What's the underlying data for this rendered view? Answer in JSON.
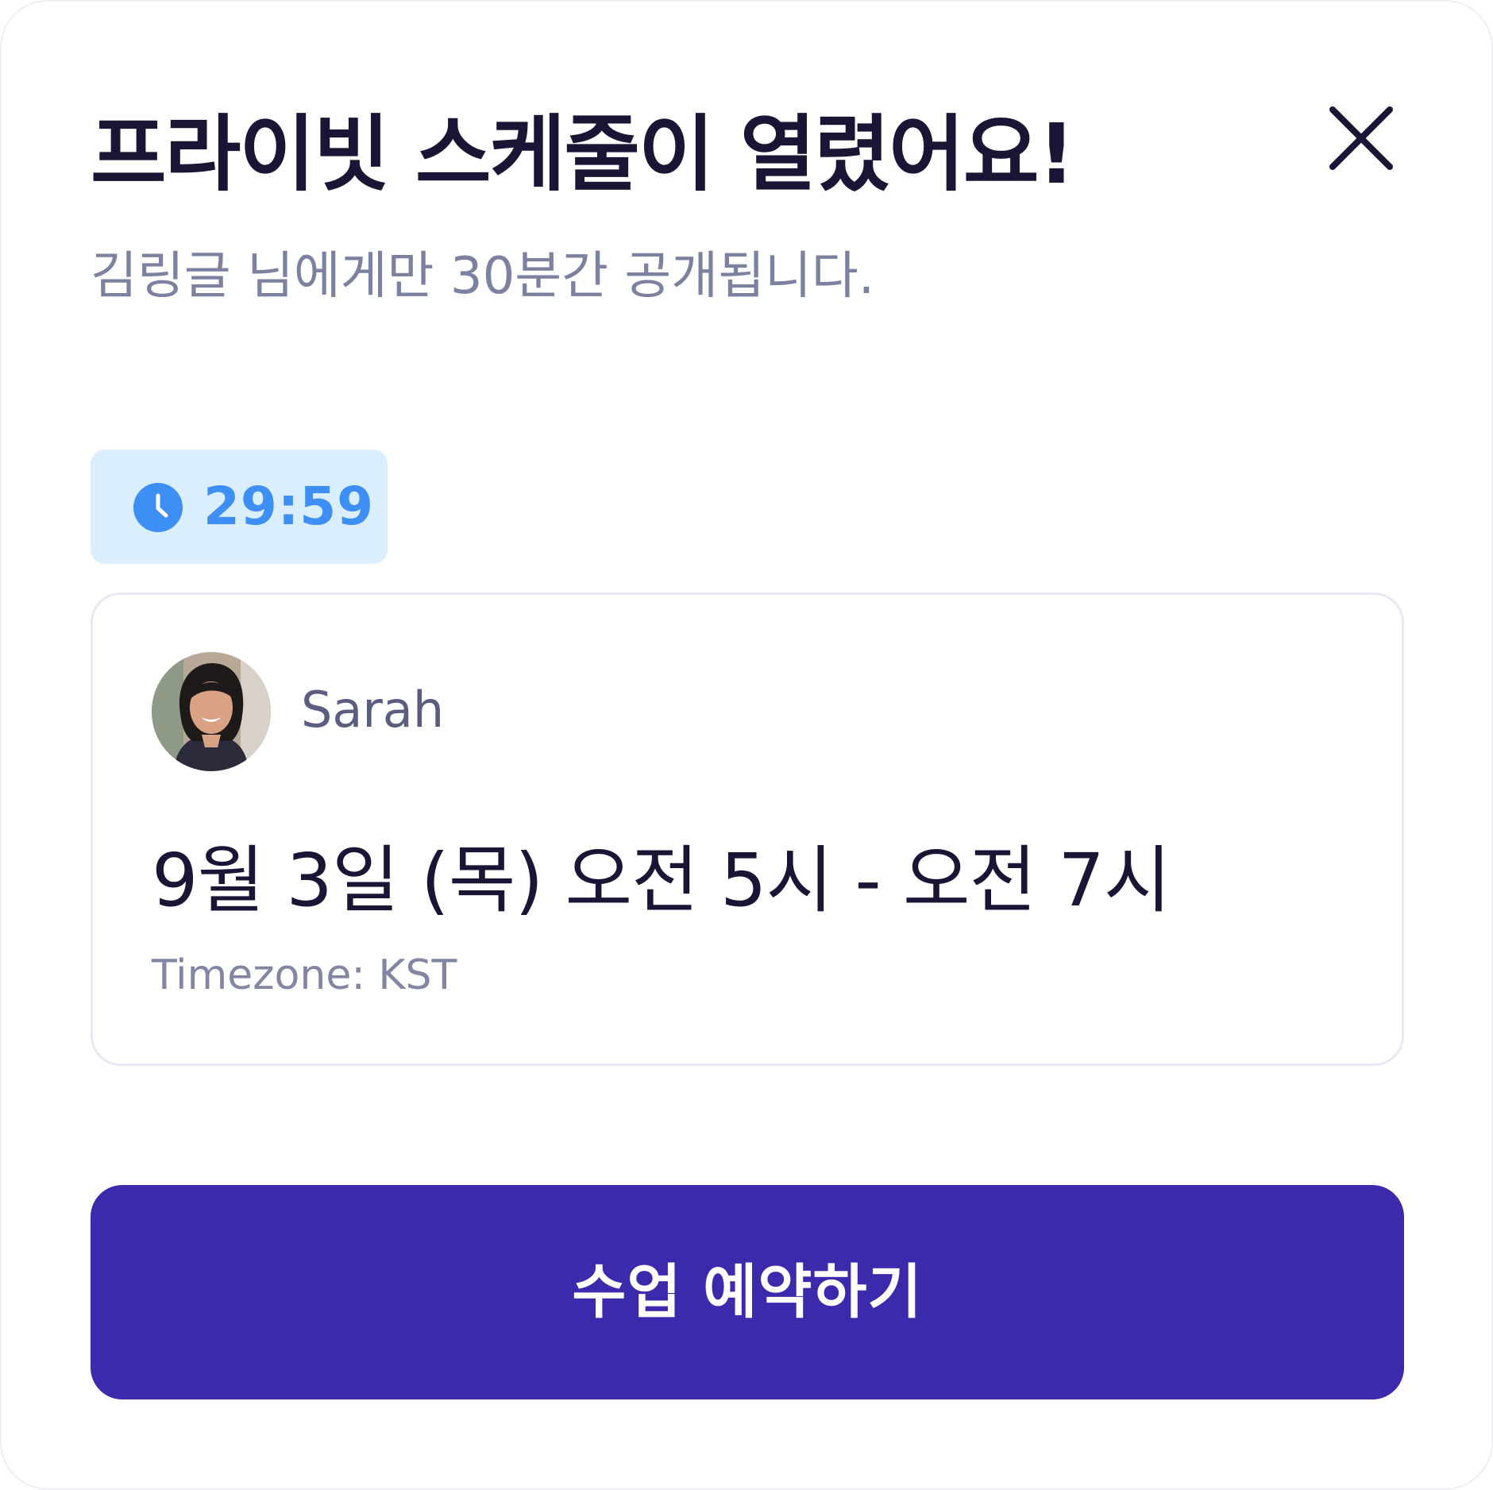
{
  "modal": {
    "title": "프라이빗 스케줄이 열렸어요!",
    "subtitle": "김링글 님에게만 30분간 공개됩니다.",
    "close_icon": "close-icon"
  },
  "timer": {
    "icon": "clock-icon",
    "value": "29:59",
    "color": "#3d8ef5",
    "background": "#dbeefe"
  },
  "lesson_card": {
    "tutor_name": "Sarah",
    "schedule": "9월 3일 (목) 오전 5시 - 오전 7시",
    "timezone": "Timezone: KST"
  },
  "cta": {
    "label": "수업 예약하기",
    "color": "#3c2aac"
  }
}
